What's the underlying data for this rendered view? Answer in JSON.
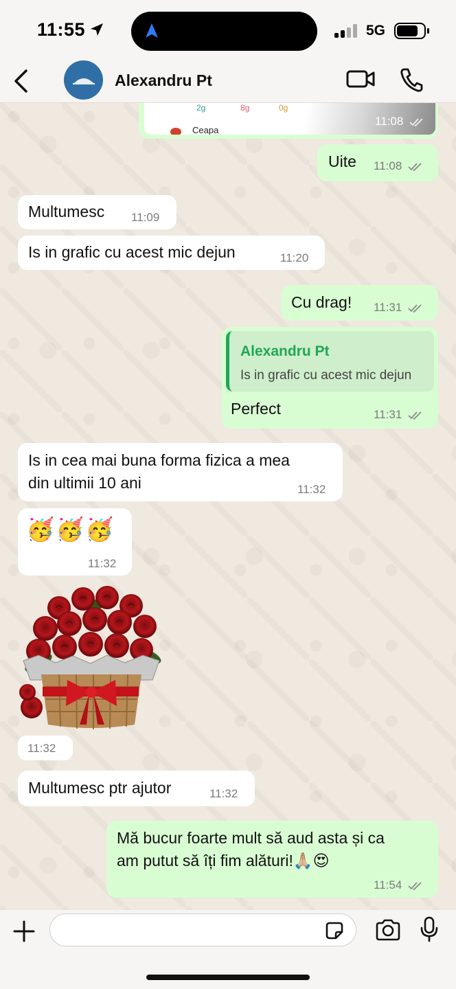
{
  "status_bar": {
    "time": "11:55",
    "network": "5G"
  },
  "header": {
    "contact_name": "Alexandru Pt"
  },
  "image_preview": {
    "nutrients": [
      "2g",
      "8g",
      "0g"
    ],
    "item_label": "Ceapa",
    "time": "11:08"
  },
  "messages": [
    {
      "text": "Uite",
      "time": "11:08"
    },
    {
      "text": "Multumesc",
      "time": "11:09"
    },
    {
      "text": "Is in grafic cu acest mic dejun",
      "time": "11:20"
    },
    {
      "text": "Cu drag!",
      "time": "11:31"
    },
    {
      "quote_author": "Alexandru Pt",
      "quote_text": "Is in grafic cu acest mic dejun",
      "text": "Perfect",
      "time": "11:31"
    },
    {
      "line1": "Is in cea mai buna forma fizica  a mea",
      "line2": "din ultimii 10 ani",
      "time": "11:32"
    },
    {
      "emoji": "🥳🥳🥳",
      "time": "11:32"
    },
    {
      "sticker": "roses-basket",
      "time": "11:32"
    },
    {
      "text": "Multumesc ptr ajutor",
      "time": "11:32"
    },
    {
      "line1": "Mă bucur foarte mult să aud asta și ca",
      "line2": "am putut să îți fim alături!🙏🏼😍",
      "time": "11:54"
    }
  ],
  "colors": {
    "outgoing": "#d9fdd3",
    "incoming": "#ffffff",
    "accent": "#1fa855",
    "wallpaper": "#efe9df"
  }
}
